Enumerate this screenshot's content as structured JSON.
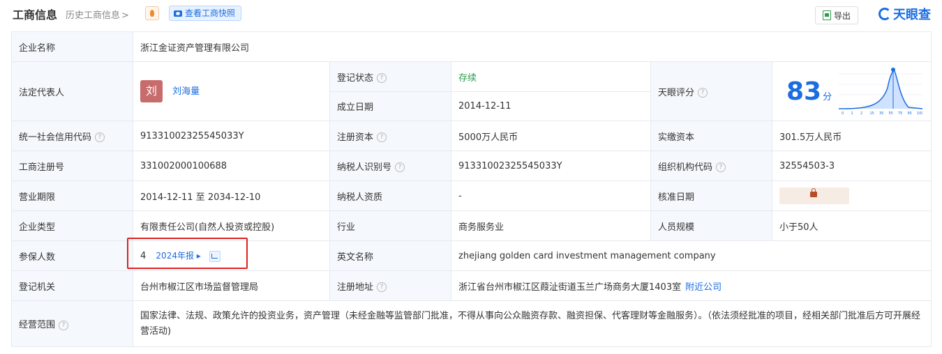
{
  "header": {
    "title": "工商信息",
    "history": "历史工商信息",
    "history_chevron": ">",
    "snapshot": "查看工商快照",
    "export": "导出",
    "brand": "天眼查"
  },
  "rows": {
    "company_name": {
      "label": "企业名称",
      "value": "浙江金证资产管理有限公司"
    },
    "legal_rep": {
      "label": "法定代表人",
      "avatar": "刘",
      "name": "刘海量"
    },
    "reg_status": {
      "label": "登记状态",
      "value": "存续"
    },
    "est_date": {
      "label": "成立日期",
      "value": "2014-12-11"
    },
    "score": {
      "label": "天眼评分",
      "value": "83",
      "unit": "分",
      "axis": [
        "0",
        "1",
        "2",
        "15",
        "35",
        "55",
        "75",
        "95",
        "100"
      ]
    },
    "credit_code": {
      "label": "统一社会信用代码",
      "value": "91331002325545033Y"
    },
    "reg_capital": {
      "label": "注册资本",
      "value": "5000万人民币"
    },
    "paid_capital": {
      "label": "实缴资本",
      "value": "301.5万人民币"
    },
    "reg_no": {
      "label": "工商注册号",
      "value": "331002000100688"
    },
    "taxpayer_id": {
      "label": "纳税人识别号",
      "value": "91331002325545033Y"
    },
    "org_code": {
      "label": "组织机构代码",
      "value": "32554503-3"
    },
    "term": {
      "label": "营业期限",
      "value": "2014-12-11 至 2034-12-10"
    },
    "tax_qual": {
      "label": "纳税人资质",
      "value": "-"
    },
    "approve_date": {
      "label": "核准日期"
    },
    "type": {
      "label": "企业类型",
      "value": "有限责任公司(自然人投资或控股)"
    },
    "industry": {
      "label": "行业",
      "value": "商务服务业"
    },
    "staff": {
      "label": "人员规模",
      "value": "小于50人"
    },
    "insured": {
      "label": "参保人数",
      "value": "4",
      "report": "2024年报"
    },
    "en_name": {
      "label": "英文名称",
      "value": "zhejiang golden card investment management company"
    },
    "authority": {
      "label": "登记机关",
      "value": "台州市椒江区市场监督管理局"
    },
    "address": {
      "label": "注册地址",
      "value": "浙江省台州市椒江区葭沚街道玉兰广场商务大厦1403室",
      "nearby": "附近公司"
    },
    "scope": {
      "label": "经营范围",
      "value": "国家法律、法规、政策允许的投资业务，资产管理（未经金融等监管部门批准，不得从事向公众融资存款、融资担保、代客理财等金融服务）。（依法须经批准的项目，经相关部门批准后方可开展经营活动)"
    }
  },
  "colors": {
    "accent": "#1b6de0",
    "status_green": "#2c9c4a",
    "highlight_red": "#e02020"
  }
}
